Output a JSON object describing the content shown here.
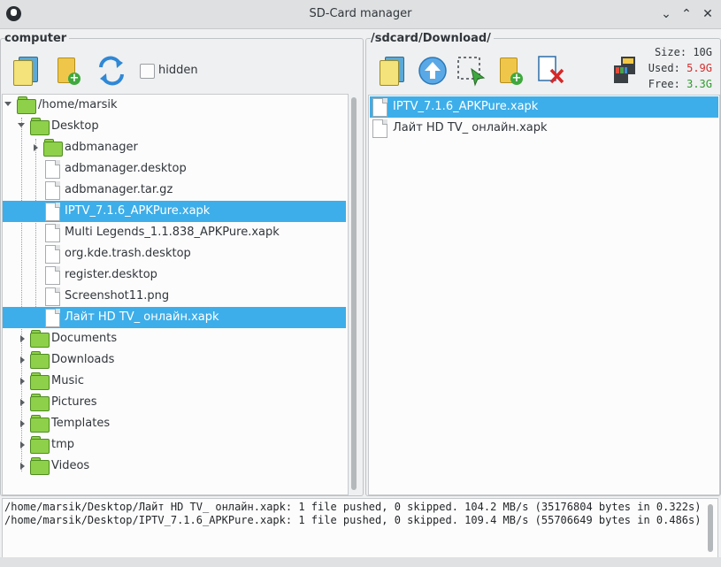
{
  "window": {
    "title": "SD-Card manager"
  },
  "left": {
    "label": "computer",
    "hidden_label": "hidden",
    "hidden_checked": false,
    "tree": [
      {
        "label": "/home/marsik",
        "type": "folder",
        "depth": 0,
        "expanded": true,
        "selected": false
      },
      {
        "label": "Desktop",
        "type": "folder",
        "depth": 1,
        "expanded": true,
        "selected": false
      },
      {
        "label": "adbmanager",
        "type": "folder",
        "depth": 2,
        "expanded": false,
        "selected": false
      },
      {
        "label": "adbmanager.desktop",
        "type": "file",
        "depth": 2,
        "selected": false
      },
      {
        "label": "adbmanager.tar.gz",
        "type": "file",
        "depth": 2,
        "selected": false
      },
      {
        "label": "IPTV_7.1.6_APKPure.xapk",
        "type": "file",
        "depth": 2,
        "selected": true
      },
      {
        "label": "Multi Legends_1.1.838_APKPure.xapk",
        "type": "file",
        "depth": 2,
        "selected": false
      },
      {
        "label": "org.kde.trash.desktop",
        "type": "file",
        "depth": 2,
        "selected": false
      },
      {
        "label": "register.desktop",
        "type": "file",
        "depth": 2,
        "selected": false
      },
      {
        "label": "Screenshot11.png",
        "type": "file",
        "depth": 2,
        "selected": false
      },
      {
        "label": "Лайт HD TV_ онлайн.xapk",
        "type": "file",
        "depth": 2,
        "selected": true
      },
      {
        "label": "Documents",
        "type": "folder",
        "depth": 1,
        "expanded": false,
        "selected": false
      },
      {
        "label": "Downloads",
        "type": "folder",
        "depth": 1,
        "expanded": false,
        "selected": false
      },
      {
        "label": "Music",
        "type": "folder",
        "depth": 1,
        "expanded": false,
        "selected": false
      },
      {
        "label": "Pictures",
        "type": "folder",
        "depth": 1,
        "expanded": false,
        "selected": false
      },
      {
        "label": "Templates",
        "type": "folder",
        "depth": 1,
        "expanded": false,
        "selected": false
      },
      {
        "label": "tmp",
        "type": "folder",
        "depth": 1,
        "expanded": false,
        "selected": false
      },
      {
        "label": "Videos",
        "type": "folder",
        "depth": 1,
        "expanded": false,
        "selected": false
      }
    ]
  },
  "right": {
    "label": "/sdcard/Download/",
    "size_label": "Size:",
    "size_value": "10G",
    "used_label": "Used:",
    "used_value": "5.9G",
    "free_label": "Free:",
    "free_value": "3.3G",
    "files": [
      {
        "label": "IPTV_7.1.6_APKPure.xapk",
        "selected": true
      },
      {
        "label": "Лайт HD TV_ онлайн.xapk",
        "selected": false
      }
    ]
  },
  "log": [
    "/home/marsik/Desktop/Лайт HD TV_ онлайн.xapk: 1 file pushed, 0 skipped. 104.2 MB/s (35176804 bytes in 0.322s)",
    "/home/marsik/Desktop/IPTV_7.1.6_APKPure.xapk: 1 file pushed, 0 skipped. 109.4 MB/s (55706649 bytes in 0.486s)"
  ],
  "colors": {
    "selection": "#3daee9",
    "used": "#d32f2f",
    "free": "#2e9b2e"
  },
  "icons": {
    "left_toolbar": [
      "copy-to-sdcard-icon",
      "new-folder-icon",
      "refresh-icon"
    ],
    "right_toolbar": [
      "copy-to-computer-icon",
      "up-icon",
      "select-icon",
      "new-folder-icon",
      "delete-icon",
      "sdcard-icon"
    ]
  }
}
